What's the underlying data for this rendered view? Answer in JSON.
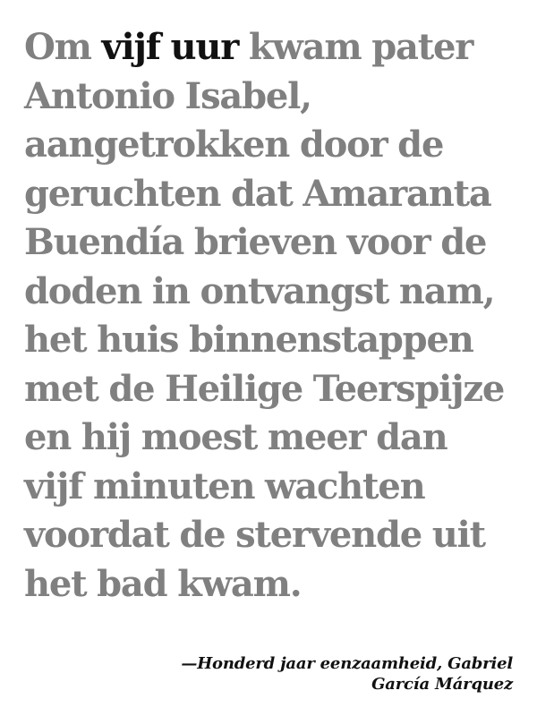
{
  "quote": {
    "line1_before": "Om ",
    "line1_highlight": "vijf uur",
    "line1_after": " kwam pater",
    "lines": [
      "Antonio Isabel,",
      "aangetrokken door de",
      "geruchten dat Amaranta",
      "Buendía brieven voor de",
      "doden in ontvangst nam,",
      "het huis binnenstappen",
      "met de Heilige Teerspijze",
      "en hij moest meer dan",
      "vijf minuten wachten",
      "voordat de stervende uit",
      "het bad kwam."
    ]
  },
  "attribution": {
    "line1": "—Honderd jaar eenzaamheid, Gabriel",
    "line2": "García Márquez"
  },
  "colors": {
    "body_text": "#808080",
    "highlight_text": "#111111",
    "background": "#ffffff"
  }
}
